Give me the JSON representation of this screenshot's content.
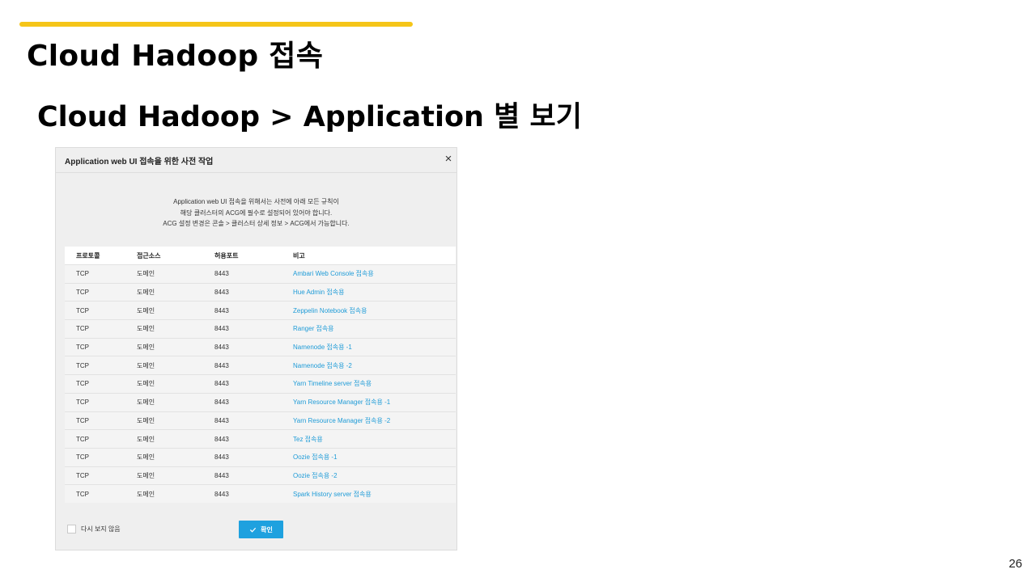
{
  "slide": {
    "title": "Cloud Hadoop 접속",
    "subtitle": "Cloud Hadoop > Application 별 보기",
    "page_number": "26",
    "accent_color": "#f5c518"
  },
  "dialog": {
    "title": "Application web UI 접속을 위한 사전 작업",
    "close_label": "×",
    "notice": [
      "Application web UI 접속을 위해서는 사전에 아래 모든 규칙이",
      "해당 클러스터의 ACG에 필수로 설정되어 있어야 합니다.",
      "ACG 설정 변경은 콘솔 > 클러스터 상세 정보 > ACG에서 가능합니다."
    ],
    "columns": [
      "프로토콜",
      "접근소스",
      "허용포트",
      "비고"
    ],
    "rows": [
      {
        "protocol": "TCP",
        "source": "도메인",
        "port": "8443",
        "note": "Ambari Web Console 접속용"
      },
      {
        "protocol": "TCP",
        "source": "도메인",
        "port": "8443",
        "note": "Hue Admin 접속용"
      },
      {
        "protocol": "TCP",
        "source": "도메인",
        "port": "8443",
        "note": "Zeppelin Notebook 접속용"
      },
      {
        "protocol": "TCP",
        "source": "도메인",
        "port": "8443",
        "note": "Ranger 접속용"
      },
      {
        "protocol": "TCP",
        "source": "도메인",
        "port": "8443",
        "note": "Namenode 접속용 -1"
      },
      {
        "protocol": "TCP",
        "source": "도메인",
        "port": "8443",
        "note": "Namenode 접속용 -2"
      },
      {
        "protocol": "TCP",
        "source": "도메인",
        "port": "8443",
        "note": "Yarn Timeline server 접속용"
      },
      {
        "protocol": "TCP",
        "source": "도메인",
        "port": "8443",
        "note": "Yarn Resource Manager 접속용 -1"
      },
      {
        "protocol": "TCP",
        "source": "도메인",
        "port": "8443",
        "note": "Yarn Resource Manager 접속용 -2"
      },
      {
        "protocol": "TCP",
        "source": "도메인",
        "port": "8443",
        "note": "Tez 접속용"
      },
      {
        "protocol": "TCP",
        "source": "도메인",
        "port": "8443",
        "note": "Oozie 접속용 -1"
      },
      {
        "protocol": "TCP",
        "source": "도메인",
        "port": "8443",
        "note": "Oozie 접속용 -2"
      },
      {
        "protocol": "TCP",
        "source": "도메인",
        "port": "8443",
        "note": "Spark History server 접속용"
      }
    ],
    "dont_show_again_label": "다시 보지 않음",
    "confirm_label": "확인",
    "confirm_icon": "check-icon",
    "link_color": "#1e9bd7",
    "button_color": "#1ea1df"
  }
}
